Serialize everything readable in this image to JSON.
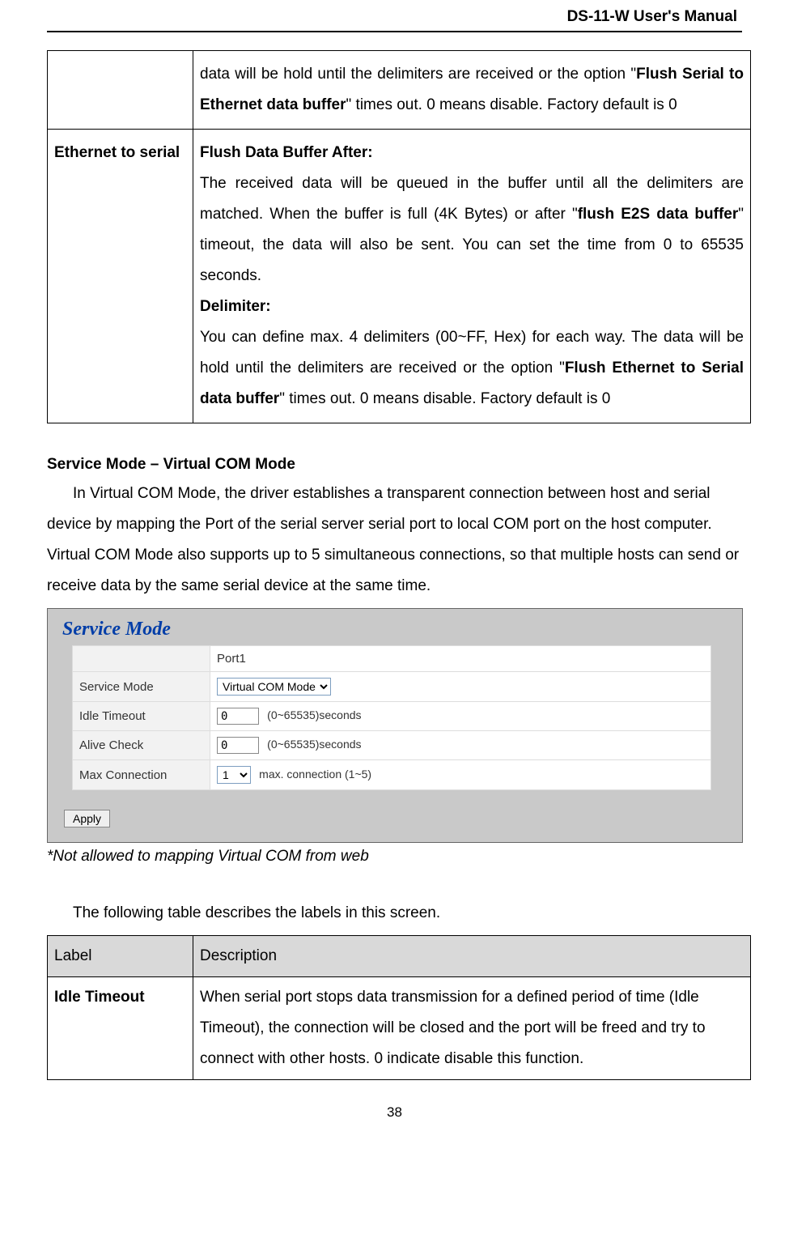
{
  "running_header": "DS-11-W User's Manual",
  "table1": {
    "row1": {
      "desc_prefix": "data will be hold until the delimiters are received or the option \"",
      "desc_bold1": "Flush Serial to Ethernet data buffer",
      "desc_mid": "\" times out.    0 means disable.  Factory default is 0"
    },
    "row2": {
      "label": "Ethernet to serial",
      "h1": "Flush Data Buffer After:",
      "p1_a": "    The received data will be queued in the buffer until all the delimiters are matched.    When the buffer is full (4K Bytes) or after \"",
      "p1_b": "flush E2S data buffer",
      "p1_c": "\" timeout, the data will also be sent.    You can set the time from 0 to 65535 seconds.",
      "h2": "Delimiter:",
      "p2_a": "You can define max. 4 delimiters (00~FF, Hex) for each way.   The data will be hold until the delimiters are received or the option \"",
      "p2_b": "Flush Ethernet to Serial data buffer",
      "p2_c": "\" times out.   0 means disable.  Factory default is 0"
    }
  },
  "section_heading": "Service Mode – Virtual COM Mode",
  "body_para": "In Virtual COM Mode, the driver establishes a transparent connection between host and serial device by mapping the Port of the serial server serial port to local COM port on the host computer.    Virtual COM Mode also supports up to 5 simultaneous connections, so that multiple hosts can send or receive data by the same serial device at the same time.",
  "screenshot": {
    "title": "Service Mode",
    "col_header": "Port1",
    "rows": {
      "service_mode": {
        "label": "Service Mode",
        "value": "Virtual COM Mode"
      },
      "idle_timeout": {
        "label": "Idle Timeout",
        "value": "0",
        "hint": "(0~65535)seconds"
      },
      "alive_check": {
        "label": "Alive Check",
        "value": "0",
        "hint": "(0~65535)seconds"
      },
      "max_connection": {
        "label": "Max Connection",
        "value": "1",
        "hint": "max. connection (1~5)"
      }
    },
    "apply": "Apply"
  },
  "footnote": "*Not allowed to mapping Virtual COM from web",
  "table2_intro": "The following table describes the labels in this screen.",
  "table2": {
    "head_label": "Label",
    "head_desc": "Description",
    "row1_label": "Idle Timeout",
    "row1_desc": "When serial port stops data transmission for a defined period of time (Idle Timeout), the connection will be closed and the port will be freed and try to connect with other hosts.   0 indicate disable this function."
  },
  "page_number": "38"
}
